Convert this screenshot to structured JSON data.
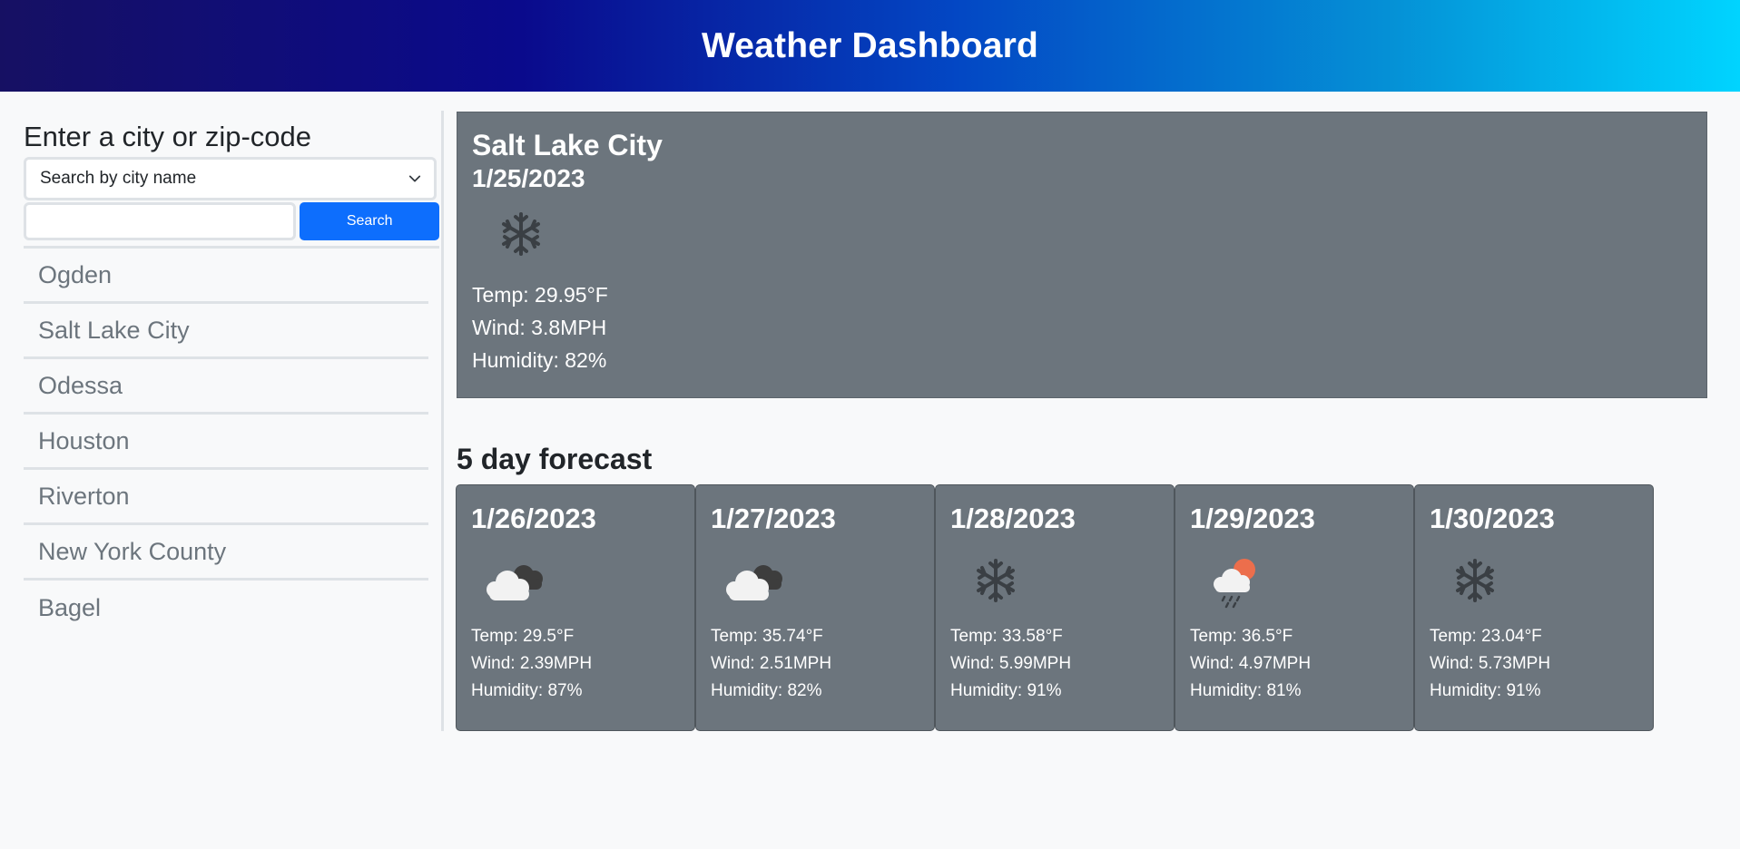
{
  "header": {
    "title": "Weather Dashboard"
  },
  "search": {
    "heading": "Enter a city or zip-code",
    "type_select": {
      "selected": "Search by city name",
      "icon": "chevron-down-icon"
    },
    "input_value": "",
    "button_label": "Search"
  },
  "history": {
    "items": [
      {
        "label": "Ogden"
      },
      {
        "label": "Salt Lake City"
      },
      {
        "label": "Odessa"
      },
      {
        "label": "Houston"
      },
      {
        "label": "Riverton"
      },
      {
        "label": "New York County"
      },
      {
        "label": "Bagel"
      }
    ]
  },
  "current": {
    "city": "Salt Lake City",
    "date": "1/25/2023",
    "icon": "snow-icon",
    "temp": "Temp: 29.95°F",
    "wind": "Wind: 3.8MPH",
    "humidity": "Humidity: 82%"
  },
  "forecast": {
    "heading": "5 day forecast",
    "days": [
      {
        "date": "1/26/2023",
        "icon": "clouds-icon",
        "temp": "Temp: 29.5°F",
        "wind": "Wind: 2.39MPH",
        "humidity": "Humidity: 87%"
      },
      {
        "date": "1/27/2023",
        "icon": "clouds-icon",
        "temp": "Temp: 35.74°F",
        "wind": "Wind: 2.51MPH",
        "humidity": "Humidity: 82%"
      },
      {
        "date": "1/28/2023",
        "icon": "snow-icon",
        "temp": "Temp: 33.58°F",
        "wind": "Wind: 5.99MPH",
        "humidity": "Humidity: 91%"
      },
      {
        "date": "1/29/2023",
        "icon": "rain-sun-icon",
        "temp": "Temp: 36.5°F",
        "wind": "Wind: 4.97MPH",
        "humidity": "Humidity: 81%"
      },
      {
        "date": "1/30/2023",
        "icon": "snow-icon",
        "temp": "Temp: 23.04°F",
        "wind": "Wind: 5.73MPH",
        "humidity": "Humidity: 91%"
      }
    ]
  },
  "colors": {
    "card_bg": "#6c757d",
    "button_bg": "#0d6efd",
    "header_gradient_start": "#161063",
    "header_gradient_end": "#00d4ff"
  }
}
